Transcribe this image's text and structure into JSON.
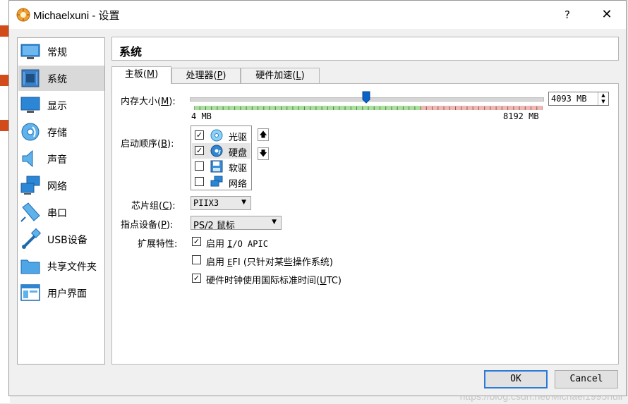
{
  "window": {
    "title": "Michaelxuni - 设置",
    "help": "?",
    "close": "✕"
  },
  "sidebar": {
    "items": [
      {
        "label": "常规",
        "icon": "general-icon"
      },
      {
        "label": "系统",
        "icon": "system-icon"
      },
      {
        "label": "显示",
        "icon": "display-icon"
      },
      {
        "label": "存储",
        "icon": "storage-icon"
      },
      {
        "label": "声音",
        "icon": "audio-icon"
      },
      {
        "label": "网络",
        "icon": "network-icon"
      },
      {
        "label": "串口",
        "icon": "serial-port-icon"
      },
      {
        "label": "USB设备",
        "icon": "usb-icon"
      },
      {
        "label": "共享文件夹",
        "icon": "shared-folder-icon"
      },
      {
        "label": "用户界面",
        "icon": "user-interface-icon"
      }
    ],
    "selected": "系统"
  },
  "header": {
    "title": "系统"
  },
  "tabs": [
    {
      "label": "主板(",
      "key": "M",
      "end": ")"
    },
    {
      "label": "处理器(",
      "key": "P",
      "end": ")"
    },
    {
      "label": "硬件加速(",
      "key": "L",
      "end": ")"
    }
  ],
  "motherboard": {
    "memory": {
      "label": "内存大小(",
      "key": "M",
      "label_end": "):",
      "value": "4093 MB",
      "min_label": "4 MB",
      "max_label": "8192 MB",
      "level_fraction": 0.4996
    },
    "boot_order": {
      "label": "启动顺序(",
      "key": "B",
      "label_end": "):",
      "items": [
        {
          "label": "光驱",
          "checked": true,
          "icon": "optical-drive-icon"
        },
        {
          "label": "硬盘",
          "checked": true,
          "icon": "hard-disk-icon"
        },
        {
          "label": "软驱",
          "checked": false,
          "icon": "floppy-icon"
        },
        {
          "label": "网络",
          "checked": false,
          "icon": "network-boot-icon"
        }
      ]
    },
    "chipset": {
      "label": "芯片组(",
      "key": "C",
      "label_end": "):",
      "value": "PIIX3"
    },
    "pointing": {
      "label": "指点设备(",
      "key": "P",
      "label_end": "):",
      "value": "PS/2 鼠标"
    },
    "extended": {
      "label": "扩展特性:",
      "options": [
        {
          "prefix": "启用 ",
          "key": "I",
          "suffix": "/O APIC",
          "checked": true
        },
        {
          "prefix": "启用 ",
          "key": "E",
          "suffix": "FI (只针对某些操作系统)",
          "checked": false
        },
        {
          "prefix": "硬件时钟使用国际标准时间(",
          "key": "U",
          "suffix": "TC)",
          "checked": true
        }
      ]
    }
  },
  "footer": {
    "ok": "OK",
    "cancel": "Cancel"
  },
  "watermark": "https://blog.csdn.net/Michael1995null",
  "colors": {
    "accent": "#2b7ad6",
    "scale_green": "#a8e19a",
    "scale_red": "#f3b6b0"
  }
}
